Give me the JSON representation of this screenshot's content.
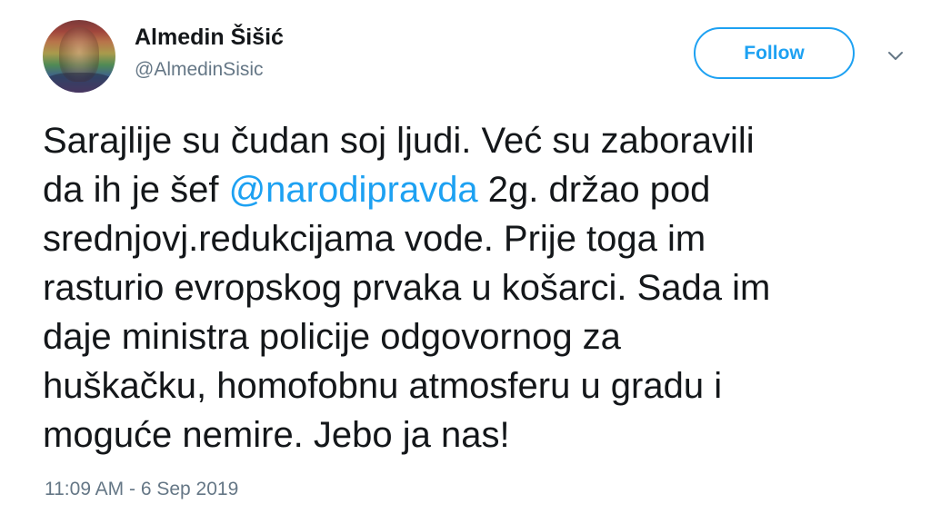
{
  "author": {
    "name": "Almedin Šišić",
    "handle": "@AlmedinSisic"
  },
  "follow_button": {
    "label": "Follow"
  },
  "menu": {
    "icon": "chevron-down-icon"
  },
  "tweet": {
    "line1": "Sarajlije su čudan soj ljudi. Već su zaboravili",
    "line2_pre": "da ih je šef ",
    "mention": "@narodipravda",
    "line2_post": " 2g. držao pod",
    "line3": "srednjovj.redukcijama vode. Prije toga im",
    "line4": "rasturio evropskog prvaka u košarci. Sada im",
    "line5": "daje ministra policije odgovornog za",
    "line6": "huškačku, homofobnu atmosferu u gradu i",
    "line7": "moguće nemire. Jebo ja nas!"
  },
  "timestamp": "11:09 AM - 6 Sep 2019",
  "colors": {
    "accent": "#1da1f2",
    "text": "#14171a",
    "secondary": "#657786"
  }
}
